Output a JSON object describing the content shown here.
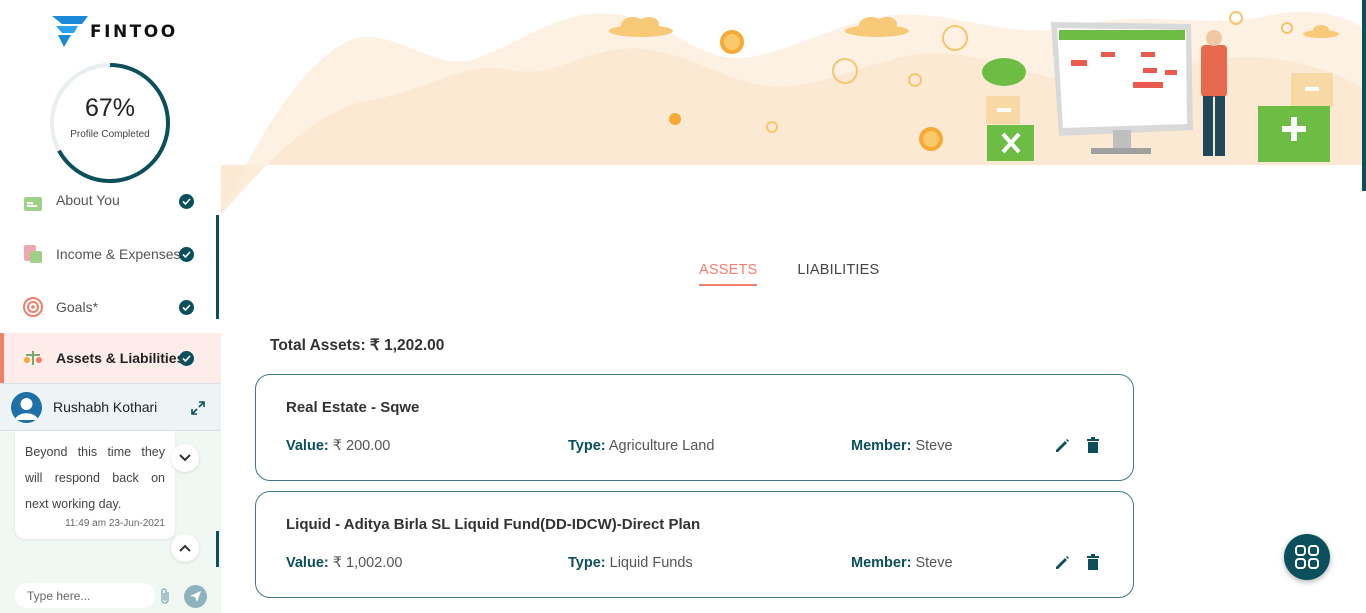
{
  "brand": {
    "name": "FINTOO"
  },
  "profile": {
    "percent_text": "67%",
    "label": "Profile Completed",
    "fraction": 0.67
  },
  "sidebar": {
    "items": [
      {
        "label": "About You",
        "icon": "about-you-icon",
        "completed": true
      },
      {
        "label": "Income & Expenses*",
        "icon": "income-expenses-icon",
        "completed": true
      },
      {
        "label": "Goals*",
        "icon": "goals-target-icon",
        "completed": true
      },
      {
        "label": "Assets & Liabilities",
        "icon": "assets-liabilities-icon",
        "completed": true,
        "active": true
      }
    ]
  },
  "chat": {
    "agent_name": "Rushabh Kothari",
    "message": "Beyond this time they will respond back on next working day.",
    "timestamp": "11:49 am 23-Jun-2021",
    "input_placeholder": "Type here..."
  },
  "tabs": [
    {
      "label": "ASSETS",
      "active": true
    },
    {
      "label": "LIABILITIES",
      "active": false
    }
  ],
  "summary": {
    "label": "Total Assets:",
    "amount": "₹ 1,202.00"
  },
  "field_labels": {
    "value": "Value:",
    "type": "Type:",
    "member": "Member:"
  },
  "assets": [
    {
      "title": "Real Estate - Sqwe",
      "value": "₹ 200.00",
      "type": "Agriculture Land",
      "member": "Steve"
    },
    {
      "title": "Liquid - Aditya Birla SL Liquid Fund(DD-IDCW)-Direct Plan",
      "value": "₹ 1,002.00",
      "type": "Liquid Funds",
      "member": "Steve"
    }
  ],
  "colors": {
    "accent": "#f0806b",
    "primary": "#0b4f5c",
    "card_border": "#3f7a8a",
    "banner_bg": "#fdf1e3"
  }
}
